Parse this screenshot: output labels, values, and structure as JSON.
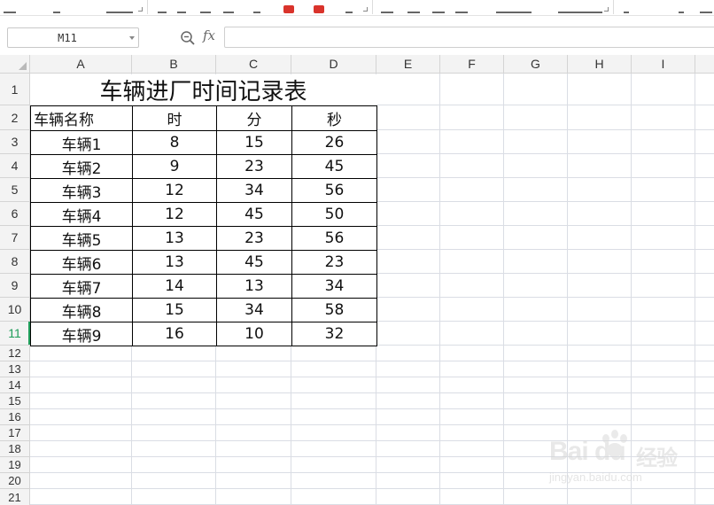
{
  "formula_bar": {
    "name_box": "M11",
    "fx_label": "fx",
    "formula_value": ""
  },
  "columns": [
    "A",
    "B",
    "C",
    "D",
    "E",
    "F",
    "G",
    "H",
    "I"
  ],
  "rows": [
    "1",
    "2",
    "3",
    "4",
    "5",
    "6",
    "7",
    "8",
    "9",
    "10",
    "11",
    "12",
    "13",
    "14",
    "15",
    "16",
    "17",
    "18",
    "19",
    "20",
    "21"
  ],
  "active_row": "11",
  "sheet": {
    "title": "车辆进厂时间记录表",
    "headers": [
      "车辆名称",
      "时",
      "分",
      "秒"
    ],
    "records": [
      [
        "车辆1",
        "8",
        "15",
        "26"
      ],
      [
        "车辆2",
        "9",
        "23",
        "45"
      ],
      [
        "车辆3",
        "12",
        "34",
        "56"
      ],
      [
        "车辆4",
        "12",
        "45",
        "50"
      ],
      [
        "车辆5",
        "13",
        "23",
        "56"
      ],
      [
        "车辆6",
        "13",
        "45",
        "23"
      ],
      [
        "车辆7",
        "14",
        "13",
        "34"
      ],
      [
        "车辆8",
        "15",
        "34",
        "58"
      ],
      [
        "车辆9",
        "16",
        "10",
        "32"
      ]
    ]
  },
  "watermark": {
    "brand": "Bai du",
    "brand_suffix": "经验",
    "site": "jingyan.baidu.com"
  }
}
